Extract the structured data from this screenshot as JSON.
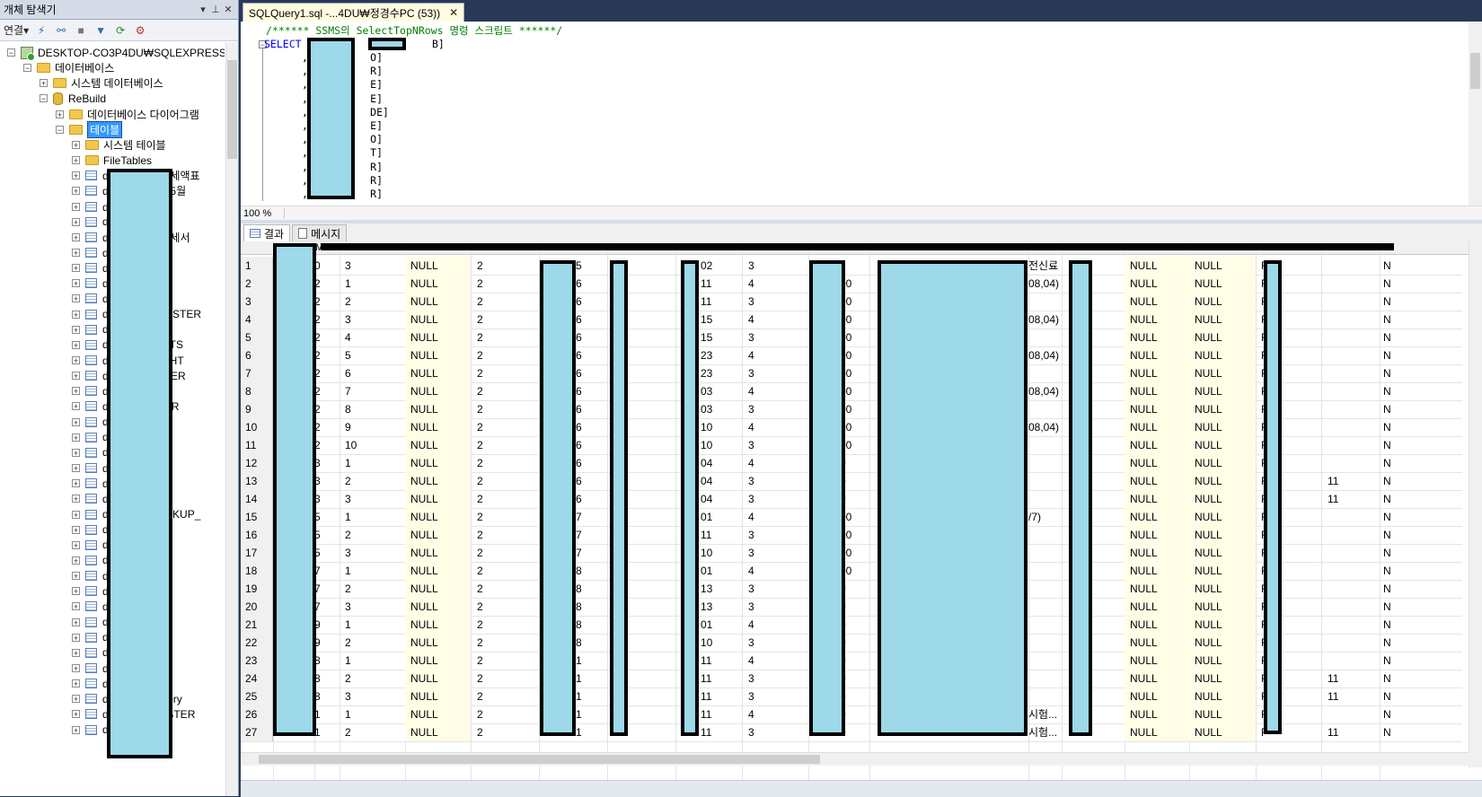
{
  "object_explorer": {
    "title": "개체 탐색기",
    "pin_icon": "▾ ₽",
    "close_icon": "✕",
    "connect_label": "연결▾",
    "tree": [
      {
        "label": "DESKTOP-CO3P4DU₩SQLEXPRESS (S",
        "kind": "server",
        "level": 0,
        "exp": "−"
      },
      {
        "label": "데이터베이스",
        "kind": "folder",
        "level": 1,
        "exp": "−"
      },
      {
        "label": "시스템 데이터베이스",
        "kind": "folder",
        "level": 2,
        "exp": "+"
      },
      {
        "label": "ReBuild",
        "kind": "db",
        "level": 2,
        "exp": "−"
      },
      {
        "label": "데이터베이스 다이어그램",
        "kind": "folder",
        "level": 3,
        "exp": "+"
      },
      {
        "label": "테이블",
        "kind": "folder",
        "level": 3,
        "exp": "−",
        "selected": true
      },
      {
        "label": "시스템 테이블",
        "kind": "folder",
        "level": 4,
        "exp": "+"
      },
      {
        "label": "FileTables",
        "kind": "folder",
        "level": 4,
        "exp": "+"
      },
      {
        "label": "d              반이세액표",
        "kind": "table",
        "level": 4,
        "exp": "+"
      },
      {
        "label": "d              자료5월",
        "kind": "table",
        "level": 4,
        "exp": "+"
      },
      {
        "label": "d              ㅋ",
        "kind": "table",
        "level": 4,
        "exp": "+"
      },
      {
        "label": "d",
        "kind": "table",
        "level": 4,
        "exp": "+"
      },
      {
        "label": "d              용명세서",
        "kind": "table",
        "level": 4,
        "exp": "+"
      },
      {
        "label": "d              ㅋ",
        "kind": "table",
        "level": 4,
        "exp": "+"
      },
      {
        "label": "d",
        "kind": "table",
        "level": 4,
        "exp": "+"
      },
      {
        "label": "d              C",
        "kind": "table",
        "level": 4,
        "exp": "+"
      },
      {
        "label": "d              FIG",
        "kind": "table",
        "level": 4,
        "exp": "+"
      },
      {
        "label": "d              _MASTER",
        "kind": "table",
        "level": 4,
        "exp": "+"
      },
      {
        "label": "d              TER",
        "kind": "table",
        "level": 4,
        "exp": "+"
      },
      {
        "label": "d              IGHTS",
        "kind": "table",
        "level": 4,
        "exp": "+"
      },
      {
        "label": "d              RIGHT",
        "kind": "table",
        "level": 4,
        "exp": "+"
      },
      {
        "label": "d              ASTER",
        "kind": "table",
        "level": 4,
        "exp": "+"
      },
      {
        "label": "d",
        "kind": "table",
        "level": 4,
        "exp": "+"
      },
      {
        "label": "d              STER",
        "kind": "table",
        "level": 4,
        "exp": "+"
      },
      {
        "label": "d              MM",
        "kind": "table",
        "level": 4,
        "exp": "+"
      },
      {
        "label": "d              SL",
        "kind": "table",
        "level": 4,
        "exp": "+"
      },
      {
        "label": "d              MM",
        "kind": "table",
        "level": 4,
        "exp": "+"
      },
      {
        "label": "d              TER",
        "kind": "table",
        "level": 4,
        "exp": "+"
      },
      {
        "label": "d              O",
        "kind": "table",
        "level": 4,
        "exp": "+"
      },
      {
        "label": "d",
        "kind": "table",
        "level": 4,
        "exp": "+"
      },
      {
        "label": "d              BACKUP_",
        "kind": "table",
        "level": 4,
        "exp": "+"
      },
      {
        "label": "d",
        "kind": "table",
        "level": 4,
        "exp": "+"
      },
      {
        "label": "d              LE",
        "kind": "table",
        "level": 4,
        "exp": "+"
      },
      {
        "label": "d",
        "kind": "table",
        "level": 4,
        "exp": "+"
      },
      {
        "label": "d              ER",
        "kind": "table",
        "level": 4,
        "exp": "+"
      },
      {
        "label": "d",
        "kind": "table",
        "level": 4,
        "exp": "+"
      },
      {
        "label": "d",
        "kind": "table",
        "level": 4,
        "exp": "+"
      },
      {
        "label": "d              E",
        "kind": "table",
        "level": 4,
        "exp": "+"
      },
      {
        "label": "d",
        "kind": "table",
        "level": 4,
        "exp": "+"
      },
      {
        "label": "d              T",
        "kind": "table",
        "level": 4,
        "exp": "+"
      },
      {
        "label": "d              DER",
        "kind": "table",
        "level": 4,
        "exp": "+"
      },
      {
        "label": "d",
        "kind": "table",
        "level": 4,
        "exp": "+"
      },
      {
        "label": "d              history",
        "kind": "table",
        "level": 4,
        "exp": "+"
      },
      {
        "label": "d              MASTER",
        "kind": "table",
        "level": 4,
        "exp": "+"
      },
      {
        "label": "d",
        "kind": "table",
        "level": 4,
        "exp": "+"
      }
    ]
  },
  "document_tab": {
    "title": "SQLQuery1.sql -...4DU₩정경수PC (53))",
    "close_icon": "✕"
  },
  "editor": {
    "comment_line": "/****** SSMS의 SelectTopNRows 명령 스크립트 ******/",
    "select_keyword": "SELECT",
    "select_rest": " T          [        B]",
    "column_lines": [
      ",[         O]",
      ",[         R]",
      ",[         E]",
      ",[         E]",
      ",[         DE]",
      ",[         E]",
      ",[         O]",
      ",[         T]",
      ",[         R]",
      ",[         R]",
      ",[         R]"
    ],
    "zoom": "100 %"
  },
  "results": {
    "tabs": [
      {
        "label": "결과",
        "icon": "grid-icon",
        "active": true
      },
      {
        "label": "메시지",
        "icon": "message-icon",
        "active": false
      }
    ],
    "header_fragment": "ME",
    "rows": [
      {
        "n": "1",
        "c2": "0",
        "c3": "3",
        "c4": "NULL",
        "c5": "2",
        "c6": "5",
        "c8": "02",
        "c9": "3",
        "c11": "",
        "c12": "전신료",
        "c13": "NULL",
        "c14": "NULL",
        "c15": "F",
        "c16": "",
        "c17": "N"
      },
      {
        "n": "2",
        "c2": "2",
        "c3": "1",
        "c4": "NULL",
        "c5": "2",
        "c6": "6",
        "c8": "11",
        "c9": "4",
        "c11": "00",
        "c12": "08,04)",
        "c13": "NULL",
        "c14": "NULL",
        "c15": "F",
        "c16": "",
        "c17": "N"
      },
      {
        "n": "3",
        "c2": "2",
        "c3": "2",
        "c4": "NULL",
        "c5": "2",
        "c6": "6",
        "c8": "11",
        "c9": "3",
        "c11": "00",
        "c12": "",
        "c13": "NULL",
        "c14": "NULL",
        "c15": "F",
        "c16": "",
        "c17": "N"
      },
      {
        "n": "4",
        "c2": "2",
        "c3": "3",
        "c4": "NULL",
        "c5": "2",
        "c6": "6",
        "c8": "15",
        "c9": "4",
        "c11": "00",
        "c12": "08,04)",
        "c13": "NULL",
        "c14": "NULL",
        "c15": "F",
        "c16": "",
        "c17": "N"
      },
      {
        "n": "5",
        "c2": "2",
        "c3": "4",
        "c4": "NULL",
        "c5": "2",
        "c6": "6",
        "c8": "15",
        "c9": "3",
        "c11": "00",
        "c12": "",
        "c13": "NULL",
        "c14": "NULL",
        "c15": "F",
        "c16": "",
        "c17": "N"
      },
      {
        "n": "6",
        "c2": "2",
        "c3": "5",
        "c4": "NULL",
        "c5": "2",
        "c6": "6",
        "c8": "23",
        "c9": "4",
        "c11": "00",
        "c12": "08,04)",
        "c13": "NULL",
        "c14": "NULL",
        "c15": "F",
        "c16": "",
        "c17": "N"
      },
      {
        "n": "7",
        "c2": "2",
        "c3": "6",
        "c4": "NULL",
        "c5": "2",
        "c6": "6",
        "c8": "23",
        "c9": "3",
        "c11": "00",
        "c12": "",
        "c13": "NULL",
        "c14": "NULL",
        "c15": "F",
        "c16": "",
        "c17": "N"
      },
      {
        "n": "8",
        "c2": "2",
        "c3": "7",
        "c4": "NULL",
        "c5": "2",
        "c6": "6",
        "c8": "03",
        "c9": "4",
        "c11": "00",
        "c12": "08,04)",
        "c13": "NULL",
        "c14": "NULL",
        "c15": "F",
        "c16": "",
        "c17": "N"
      },
      {
        "n": "9",
        "c2": "2",
        "c3": "8",
        "c4": "NULL",
        "c5": "2",
        "c6": "6",
        "c8": "03",
        "c9": "3",
        "c11": "00",
        "c12": "",
        "c13": "NULL",
        "c14": "NULL",
        "c15": "F",
        "c16": "",
        "c17": "N"
      },
      {
        "n": "10",
        "c2": "2",
        "c3": "9",
        "c4": "NULL",
        "c5": "2",
        "c6": "6",
        "c8": "10",
        "c9": "4",
        "c11": "00",
        "c12": "08,04)",
        "c13": "NULL",
        "c14": "NULL",
        "c15": "F",
        "c16": "",
        "c17": "N"
      },
      {
        "n": "11",
        "c2": "2",
        "c3": "10",
        "c4": "NULL",
        "c5": "2",
        "c6": "6",
        "c8": "10",
        "c9": "3",
        "c11": "00",
        "c12": "",
        "c13": "NULL",
        "c14": "NULL",
        "c15": "F",
        "c16": "",
        "c17": "N"
      },
      {
        "n": "12",
        "c2": "3",
        "c3": "1",
        "c4": "NULL",
        "c5": "2",
        "c6": "6",
        "c8": "04",
        "c9": "4",
        "c11": "0",
        "c12": "",
        "c13": "NULL",
        "c14": "NULL",
        "c15": "F",
        "c16": "",
        "c17": "N"
      },
      {
        "n": "13",
        "c2": "3",
        "c3": "2",
        "c4": "NULL",
        "c5": "2",
        "c6": "6",
        "c8": "04",
        "c9": "3",
        "c11": "0",
        "c12": "",
        "c13": "NULL",
        "c14": "NULL",
        "c15": "F",
        "c16": "11",
        "c17": "N"
      },
      {
        "n": "14",
        "c2": "3",
        "c3": "3",
        "c4": "NULL",
        "c5": "2",
        "c6": "6",
        "c8": "04",
        "c9": "3",
        "c11": "0",
        "c12": "",
        "c13": "NULL",
        "c14": "NULL",
        "c15": "F",
        "c16": "11",
        "c17": "N"
      },
      {
        "n": "15",
        "c2": "5",
        "c3": "1",
        "c4": "NULL",
        "c5": "2",
        "c6": "7",
        "c8": "01",
        "c9": "4",
        "c11": "00",
        "c12": "/7)",
        "c13": "NULL",
        "c14": "NULL",
        "c15": "F",
        "c16": "",
        "c17": "N"
      },
      {
        "n": "16",
        "c2": "5",
        "c3": "2",
        "c4": "NULL",
        "c5": "2",
        "c6": "7",
        "c8": "11",
        "c9": "3",
        "c11": "00",
        "c12": "",
        "c13": "NULL",
        "c14": "NULL",
        "c15": "F",
        "c16": "",
        "c17": "N"
      },
      {
        "n": "17",
        "c2": "5",
        "c3": "3",
        "c4": "NULL",
        "c5": "2",
        "c6": "7",
        "c8": "10",
        "c9": "3",
        "c11": "00",
        "c12": "",
        "c13": "NULL",
        "c14": "NULL",
        "c15": "F",
        "c16": "",
        "c17": "N"
      },
      {
        "n": "18",
        "c2": "7",
        "c3": "1",
        "c4": "NULL",
        "c5": "2",
        "c6": "8",
        "c8": "01",
        "c9": "4",
        "c11": "00",
        "c12": "",
        "c13": "NULL",
        "c14": "NULL",
        "c15": "F",
        "c16": "",
        "c17": "N"
      },
      {
        "n": "19",
        "c2": "7",
        "c3": "2",
        "c4": "NULL",
        "c5": "2",
        "c6": "8",
        "c8": "13",
        "c9": "3",
        "c11": "0",
        "c12": "",
        "c13": "NULL",
        "c14": "NULL",
        "c15": "F",
        "c16": "",
        "c17": "N"
      },
      {
        "n": "20",
        "c2": "7",
        "c3": "3",
        "c4": "NULL",
        "c5": "2",
        "c6": "8",
        "c8": "13",
        "c9": "3",
        "c11": "0",
        "c12": "",
        "c13": "NULL",
        "c14": "NULL",
        "c15": "F",
        "c16": "",
        "c17": "N"
      },
      {
        "n": "21",
        "c2": "9",
        "c3": "1",
        "c4": "NULL",
        "c5": "2",
        "c6": "8",
        "c8": "01",
        "c9": "4",
        "c11": "0",
        "c12": "",
        "c13": "NULL",
        "c14": "NULL",
        "c15": "F",
        "c16": "",
        "c17": "N"
      },
      {
        "n": "22",
        "c2": "9",
        "c3": "2",
        "c4": "NULL",
        "c5": "2",
        "c6": "8",
        "c8": "10",
        "c9": "3",
        "c11": "0",
        "c12": "",
        "c13": "NULL",
        "c14": "NULL",
        "c15": "F",
        "c16": "",
        "c17": "N"
      },
      {
        "n": "23",
        "c2": "8",
        "c3": "1",
        "c4": "NULL",
        "c5": "2",
        "c6": "1",
        "c8": "11",
        "c9": "4",
        "c11": "0",
        "c12": "",
        "c13": "NULL",
        "c14": "NULL",
        "c15": "F",
        "c16": "",
        "c17": "N"
      },
      {
        "n": "24",
        "c2": "8",
        "c3": "2",
        "c4": "NULL",
        "c5": "2",
        "c6": "1",
        "c8": "11",
        "c9": "3",
        "c11": "0",
        "c12": "",
        "c13": "NULL",
        "c14": "NULL",
        "c15": "F",
        "c16": "11",
        "c17": "N"
      },
      {
        "n": "25",
        "c2": "8",
        "c3": "3",
        "c4": "NULL",
        "c5": "2",
        "c6": "1",
        "c8": "11",
        "c9": "3",
        "c11": "0",
        "c12": "",
        "c13": "NULL",
        "c14": "NULL",
        "c15": "F",
        "c16": "11",
        "c17": "N"
      },
      {
        "n": "26",
        "c2": "1",
        "c3": "1",
        "c4": "NULL",
        "c5": "2",
        "c6": "1",
        "c8": "11",
        "c9": "4",
        "c11": "0",
        "c12": "시험...",
        "c13": "NULL",
        "c14": "NULL",
        "c15": "F",
        "c16": "",
        "c17": "N"
      },
      {
        "n": "27",
        "c2": "1",
        "c3": "2",
        "c4": "NULL",
        "c5": "2",
        "c6": "1",
        "c8": "11",
        "c9": "3",
        "c11": "0",
        "c12": "시험...",
        "c13": "NULL",
        "c14": "NULL",
        "c15": "F",
        "c16": "11",
        "c17": "N"
      }
    ]
  },
  "colors": {
    "frame": "#293955",
    "null_cell_bg": "#fffde6",
    "redaction_fill": "#9dd9e8",
    "selection": "#3399ff"
  }
}
